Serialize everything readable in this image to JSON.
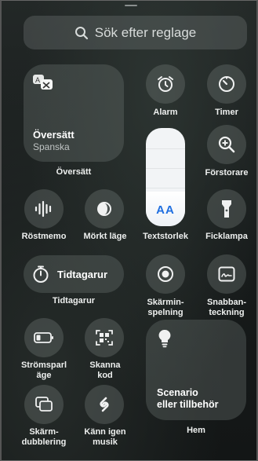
{
  "search": {
    "placeholder": "Sök efter reglage"
  },
  "translate": {
    "title": "Översätt",
    "language": "Spanska",
    "label": "Översätt"
  },
  "alarm": {
    "label": "Alarm"
  },
  "timer": {
    "label": "Timer"
  },
  "magnifier": {
    "label": "Förstorare"
  },
  "text_size": {
    "glyph": "AA",
    "label": "Textstorlek",
    "level": 0.35
  },
  "voice_memo": {
    "label": "Röstmemo"
  },
  "dark_mode": {
    "label": "Mörkt läge"
  },
  "flashlight": {
    "label": "Ficklampa"
  },
  "stopwatch": {
    "title": "Tidtagarur",
    "label": "Tidtagarur"
  },
  "screen_recording": {
    "label_line1": "Skärmin-",
    "label_line2": "spelning"
  },
  "quick_note": {
    "label_line1": "Snabban-",
    "label_line2": "teckning"
  },
  "low_power": {
    "label_line1": "Strömsparl",
    "label_line2": "äge"
  },
  "scan_code": {
    "label_line1": "Skanna",
    "label_line2": "kod"
  },
  "home": {
    "title_line1": "Scenario",
    "title_line2": "eller tillbehör",
    "label": "Hem"
  },
  "screen_mirroring": {
    "label_line1": "Skärm-",
    "label_line2": "dubblering"
  },
  "shazam": {
    "label_line1": "Känn igen",
    "label_line2": "musik"
  },
  "colors": {
    "tile_bg": "#4a5150",
    "text_size_bg": "#f2f4f6",
    "text_size_accent": "#1f6fe0"
  }
}
